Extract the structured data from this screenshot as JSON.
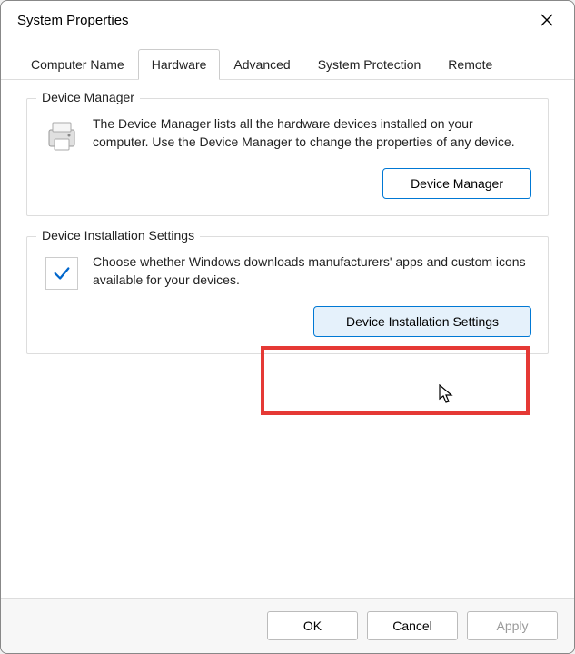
{
  "window": {
    "title": "System Properties"
  },
  "tabs": {
    "computer_name": "Computer Name",
    "hardware": "Hardware",
    "advanced": "Advanced",
    "system_protection": "System Protection",
    "remote": "Remote",
    "active": "hardware"
  },
  "device_manager": {
    "label": "Device Manager",
    "description": "The Device Manager lists all the hardware devices installed on your computer. Use the Device Manager to change the properties of any device.",
    "button": "Device Manager"
  },
  "device_installation": {
    "label": "Device Installation Settings",
    "description": "Choose whether Windows downloads manufacturers' apps and custom icons available for your devices.",
    "button": "Device Installation Settings"
  },
  "footer": {
    "ok": "OK",
    "cancel": "Cancel",
    "apply": "Apply"
  }
}
